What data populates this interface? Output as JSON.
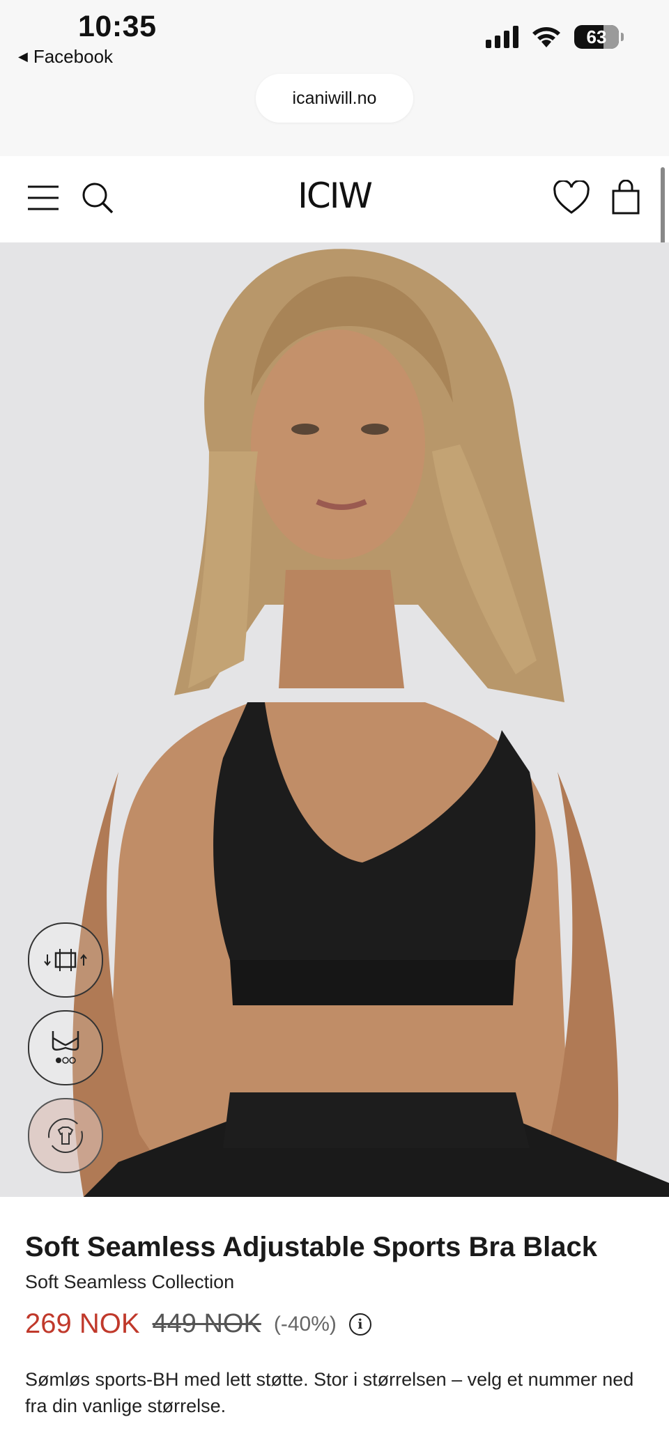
{
  "status_bar": {
    "time": "10:35",
    "back_app": "Facebook",
    "battery": "63",
    "icons": [
      "cellular-signal-icon",
      "wifi-icon",
      "battery-icon"
    ]
  },
  "browser": {
    "url": "icaniwill.no"
  },
  "header": {
    "logo": "ICIW",
    "icons": [
      "menu-icon",
      "search-icon",
      "wishlist-heart-icon",
      "shopping-bag-icon"
    ]
  },
  "gallery": {
    "floating_buttons": [
      "size-guide-icon",
      "bra-support-level-icon",
      "returns-exchange-icon"
    ]
  },
  "product": {
    "title": "Soft Seamless Adjustable Sports Bra Black",
    "collection": "Soft Seamless Collection",
    "price": "269 NOK",
    "original_price": "449 NOK",
    "discount": "(-40%)",
    "description": "Sømløs sports-BH med lett støtte. Stor i størrelsen – velg et nummer ned fra din vanlige størrelse."
  },
  "colors": {
    "sale_price": "#c0392b",
    "hero_background": "#e4e4e6",
    "garment": "#1c1c1c"
  }
}
